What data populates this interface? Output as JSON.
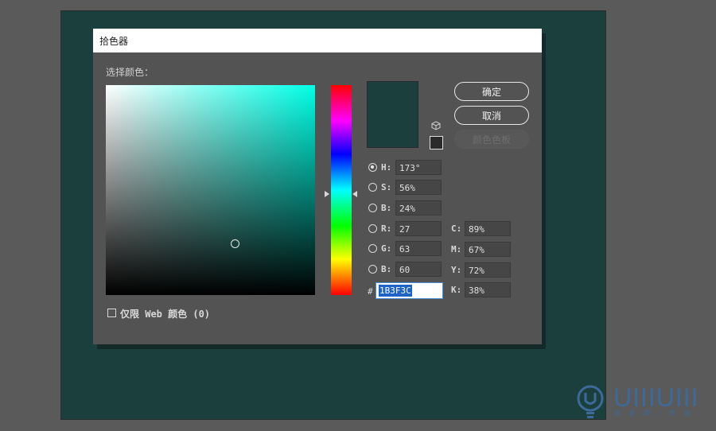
{
  "dialog": {
    "title": "拾色器",
    "select_label": "选择颜色：",
    "buttons": {
      "ok": "确定",
      "cancel": "取消",
      "swatches": "颜色色板"
    },
    "hsb": [
      {
        "label": "H:",
        "value": "173°",
        "checked": true
      },
      {
        "label": "S:",
        "value": "56%",
        "checked": false
      },
      {
        "label": "B:",
        "value": "24%",
        "checked": false
      }
    ],
    "rgb": [
      {
        "label": "R:",
        "value": "27"
      },
      {
        "label": "G:",
        "value": "63"
      },
      {
        "label": "B:",
        "value": "60"
      }
    ],
    "cmyk": [
      {
        "label": "C:",
        "value": "89%"
      },
      {
        "label": "M:",
        "value": "67%"
      },
      {
        "label": "Y:",
        "value": "72%"
      },
      {
        "label": "K:",
        "value": "38%"
      }
    ],
    "hex_label": "#",
    "hex_value": "1B3F3C",
    "websafe_label": "仅限 Web 颜色 (0)",
    "websafe_checked": false
  },
  "colors": {
    "current": "#1b3f3c",
    "hue_pure": "#00ffe6",
    "dialog_bg": "#535353",
    "canvas_bg": "#1b3f3c"
  },
  "icons": {
    "cube": "websafe-cube-icon",
    "watermark_bulb": "lightbulb-icon"
  },
  "watermark": {
    "text": "UIIIUIII",
    "sub": "优 设 网 / 优 设"
  }
}
